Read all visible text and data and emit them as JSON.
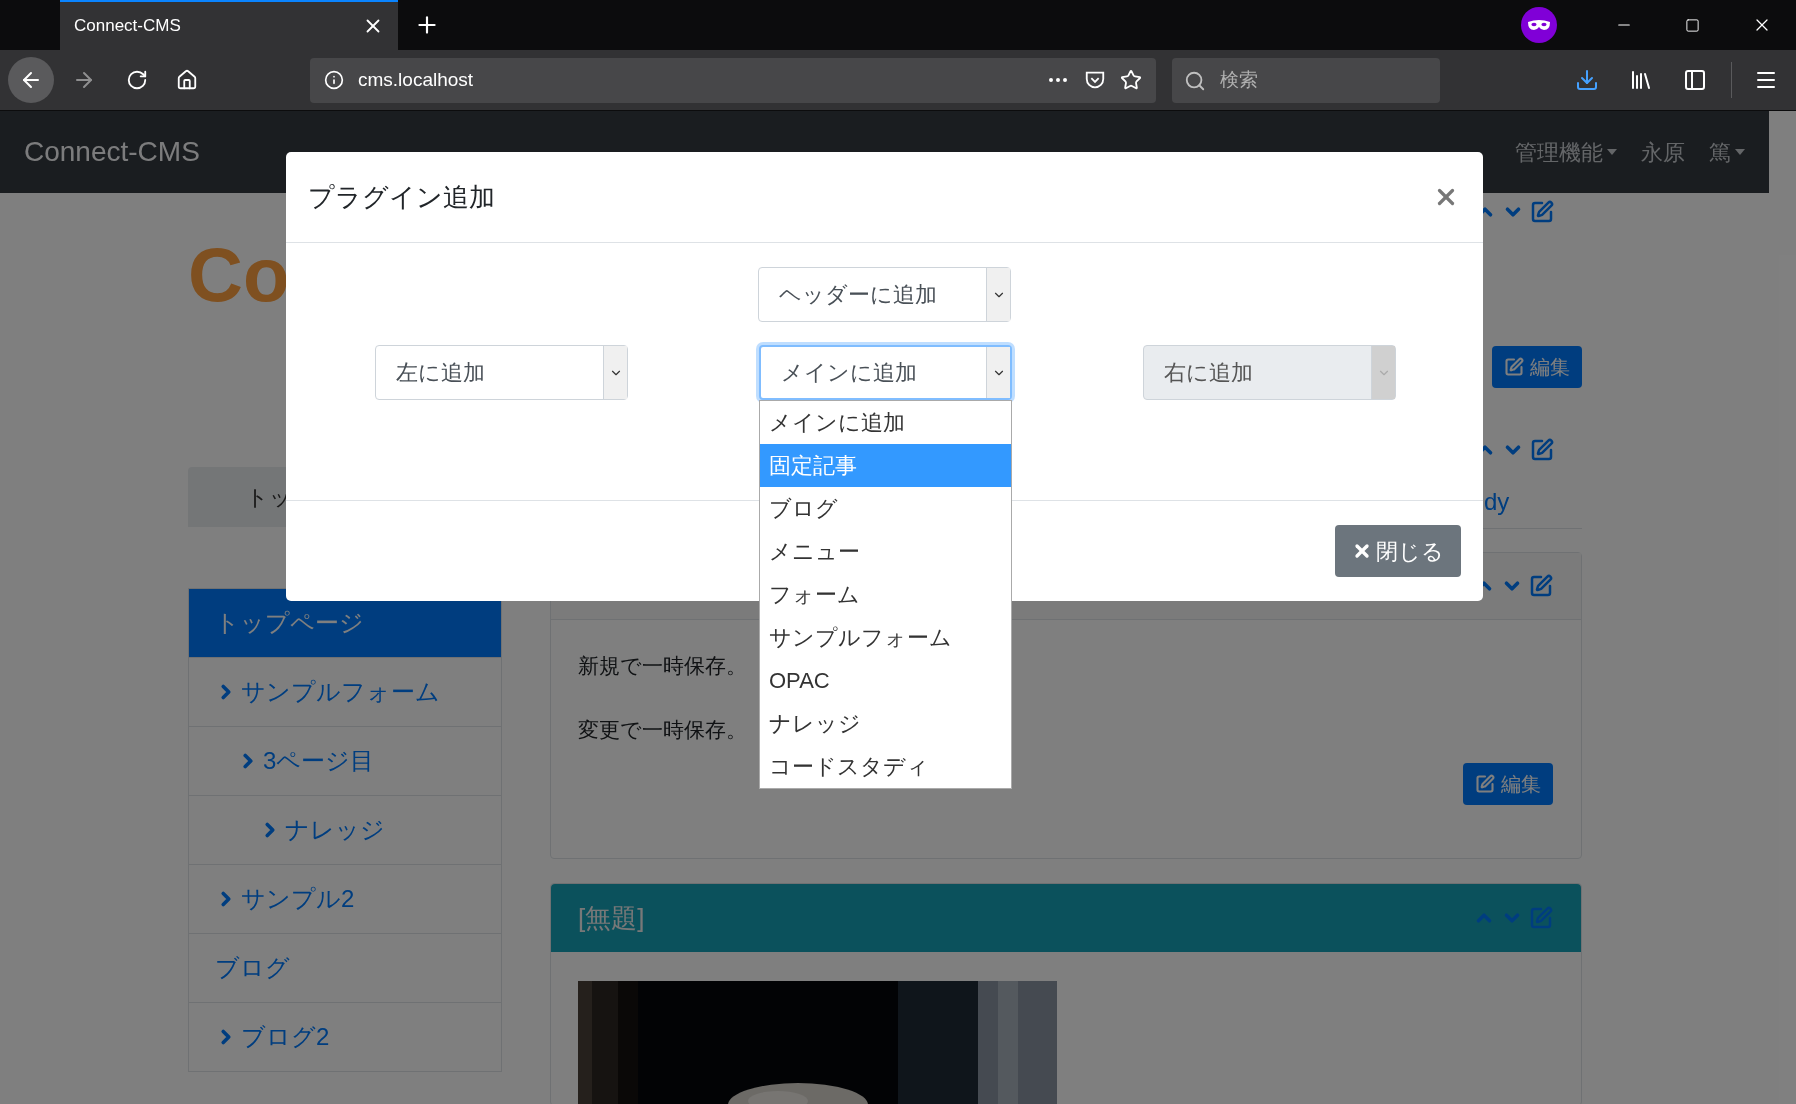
{
  "browser": {
    "tab": {
      "title": "Connect-CMS"
    },
    "url": "cms.localhost",
    "search": {
      "placeholder": "検索"
    }
  },
  "navbar": {
    "brand": "Connect-CMS",
    "items": [
      {
        "label": "管理機能",
        "dropdown": true
      },
      {
        "label": "永原",
        "dropdown": false
      },
      {
        "label": "篤",
        "dropdown": true
      }
    ]
  },
  "page": {
    "logo": "Co",
    "tab": "トッ",
    "link_fragment": "dy",
    "edit_button": "編集",
    "sidebar": [
      {
        "label": "トップページ",
        "selected": true,
        "chevron": false
      },
      {
        "label": "サンプルフォーム",
        "selected": false,
        "chevron": true,
        "children": [
          {
            "label": "3ページ目",
            "selected": false,
            "chevron": true,
            "children": [
              {
                "label": "ナレッジ",
                "selected": false,
                "chevron": true
              }
            ]
          }
        ]
      },
      {
        "label": "サンプル2",
        "selected": false,
        "chevron": true
      },
      {
        "label": "ブログ",
        "selected": false,
        "chevron": false
      },
      {
        "label": "ブログ2",
        "selected": false,
        "chevron": true
      }
    ],
    "cards": [
      {
        "kind": "text",
        "texts": [
          "新規で一時保存。",
          "変更で一時保存。"
        ],
        "edit_button": "編集"
      },
      {
        "kind": "picture",
        "title": "[無題]"
      }
    ]
  },
  "modal": {
    "title": "プラグイン追加",
    "selects": [
      {
        "value": "ヘッダーに追加",
        "disabled": false,
        "focused": false
      },
      {
        "value": "左に追加",
        "disabled": false,
        "focused": false
      },
      {
        "value": "メインに追加",
        "disabled": false,
        "focused": true,
        "open": true,
        "options": [
          {
            "label": "メインに追加",
            "highlighted": false
          },
          {
            "label": "固定記事",
            "highlighted": true
          },
          {
            "label": "ブログ",
            "highlighted": false
          },
          {
            "label": "メニュー",
            "highlighted": false
          },
          {
            "label": "フォーム",
            "highlighted": false
          },
          {
            "label": "サンプルフォーム",
            "highlighted": false
          },
          {
            "label": "OPAC",
            "highlighted": false
          },
          {
            "label": "ナレッジ",
            "highlighted": false
          },
          {
            "label": "コードスタディ",
            "highlighted": false
          }
        ]
      },
      {
        "value": "右に追加",
        "disabled": true,
        "focused": false
      }
    ],
    "close_button": "閉じる"
  }
}
